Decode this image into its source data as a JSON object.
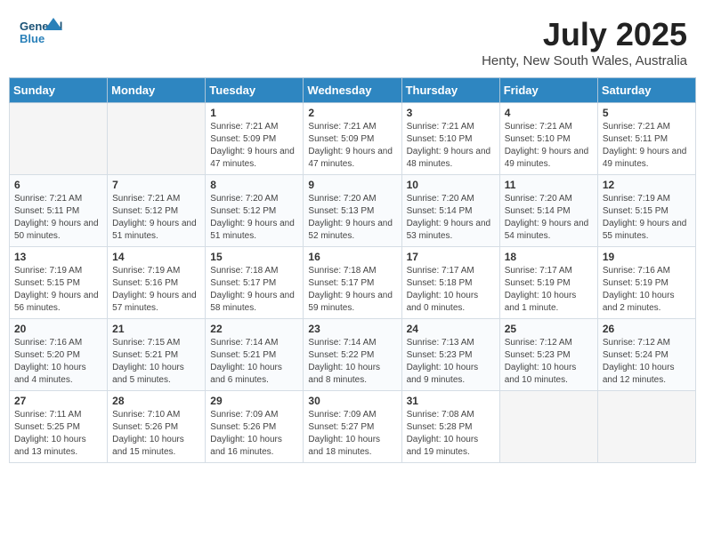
{
  "logo": {
    "general": "General",
    "blue": "Blue"
  },
  "title": "July 2025",
  "subtitle": "Henty, New South Wales, Australia",
  "days_of_week": [
    "Sunday",
    "Monday",
    "Tuesday",
    "Wednesday",
    "Thursday",
    "Friday",
    "Saturday"
  ],
  "weeks": [
    [
      {
        "day": "",
        "info": ""
      },
      {
        "day": "",
        "info": ""
      },
      {
        "day": "1",
        "info": "Sunrise: 7:21 AM\nSunset: 5:09 PM\nDaylight: 9 hours and 47 minutes."
      },
      {
        "day": "2",
        "info": "Sunrise: 7:21 AM\nSunset: 5:09 PM\nDaylight: 9 hours and 47 minutes."
      },
      {
        "day": "3",
        "info": "Sunrise: 7:21 AM\nSunset: 5:10 PM\nDaylight: 9 hours and 48 minutes."
      },
      {
        "day": "4",
        "info": "Sunrise: 7:21 AM\nSunset: 5:10 PM\nDaylight: 9 hours and 49 minutes."
      },
      {
        "day": "5",
        "info": "Sunrise: 7:21 AM\nSunset: 5:11 PM\nDaylight: 9 hours and 49 minutes."
      }
    ],
    [
      {
        "day": "6",
        "info": "Sunrise: 7:21 AM\nSunset: 5:11 PM\nDaylight: 9 hours and 50 minutes."
      },
      {
        "day": "7",
        "info": "Sunrise: 7:21 AM\nSunset: 5:12 PM\nDaylight: 9 hours and 51 minutes."
      },
      {
        "day": "8",
        "info": "Sunrise: 7:20 AM\nSunset: 5:12 PM\nDaylight: 9 hours and 51 minutes."
      },
      {
        "day": "9",
        "info": "Sunrise: 7:20 AM\nSunset: 5:13 PM\nDaylight: 9 hours and 52 minutes."
      },
      {
        "day": "10",
        "info": "Sunrise: 7:20 AM\nSunset: 5:14 PM\nDaylight: 9 hours and 53 minutes."
      },
      {
        "day": "11",
        "info": "Sunrise: 7:20 AM\nSunset: 5:14 PM\nDaylight: 9 hours and 54 minutes."
      },
      {
        "day": "12",
        "info": "Sunrise: 7:19 AM\nSunset: 5:15 PM\nDaylight: 9 hours and 55 minutes."
      }
    ],
    [
      {
        "day": "13",
        "info": "Sunrise: 7:19 AM\nSunset: 5:15 PM\nDaylight: 9 hours and 56 minutes."
      },
      {
        "day": "14",
        "info": "Sunrise: 7:19 AM\nSunset: 5:16 PM\nDaylight: 9 hours and 57 minutes."
      },
      {
        "day": "15",
        "info": "Sunrise: 7:18 AM\nSunset: 5:17 PM\nDaylight: 9 hours and 58 minutes."
      },
      {
        "day": "16",
        "info": "Sunrise: 7:18 AM\nSunset: 5:17 PM\nDaylight: 9 hours and 59 minutes."
      },
      {
        "day": "17",
        "info": "Sunrise: 7:17 AM\nSunset: 5:18 PM\nDaylight: 10 hours and 0 minutes."
      },
      {
        "day": "18",
        "info": "Sunrise: 7:17 AM\nSunset: 5:19 PM\nDaylight: 10 hours and 1 minute."
      },
      {
        "day": "19",
        "info": "Sunrise: 7:16 AM\nSunset: 5:19 PM\nDaylight: 10 hours and 2 minutes."
      }
    ],
    [
      {
        "day": "20",
        "info": "Sunrise: 7:16 AM\nSunset: 5:20 PM\nDaylight: 10 hours and 4 minutes."
      },
      {
        "day": "21",
        "info": "Sunrise: 7:15 AM\nSunset: 5:21 PM\nDaylight: 10 hours and 5 minutes."
      },
      {
        "day": "22",
        "info": "Sunrise: 7:14 AM\nSunset: 5:21 PM\nDaylight: 10 hours and 6 minutes."
      },
      {
        "day": "23",
        "info": "Sunrise: 7:14 AM\nSunset: 5:22 PM\nDaylight: 10 hours and 8 minutes."
      },
      {
        "day": "24",
        "info": "Sunrise: 7:13 AM\nSunset: 5:23 PM\nDaylight: 10 hours and 9 minutes."
      },
      {
        "day": "25",
        "info": "Sunrise: 7:12 AM\nSunset: 5:23 PM\nDaylight: 10 hours and 10 minutes."
      },
      {
        "day": "26",
        "info": "Sunrise: 7:12 AM\nSunset: 5:24 PM\nDaylight: 10 hours and 12 minutes."
      }
    ],
    [
      {
        "day": "27",
        "info": "Sunrise: 7:11 AM\nSunset: 5:25 PM\nDaylight: 10 hours and 13 minutes."
      },
      {
        "day": "28",
        "info": "Sunrise: 7:10 AM\nSunset: 5:26 PM\nDaylight: 10 hours and 15 minutes."
      },
      {
        "day": "29",
        "info": "Sunrise: 7:09 AM\nSunset: 5:26 PM\nDaylight: 10 hours and 16 minutes."
      },
      {
        "day": "30",
        "info": "Sunrise: 7:09 AM\nSunset: 5:27 PM\nDaylight: 10 hours and 18 minutes."
      },
      {
        "day": "31",
        "info": "Sunrise: 7:08 AM\nSunset: 5:28 PM\nDaylight: 10 hours and 19 minutes."
      },
      {
        "day": "",
        "info": ""
      },
      {
        "day": "",
        "info": ""
      }
    ]
  ]
}
